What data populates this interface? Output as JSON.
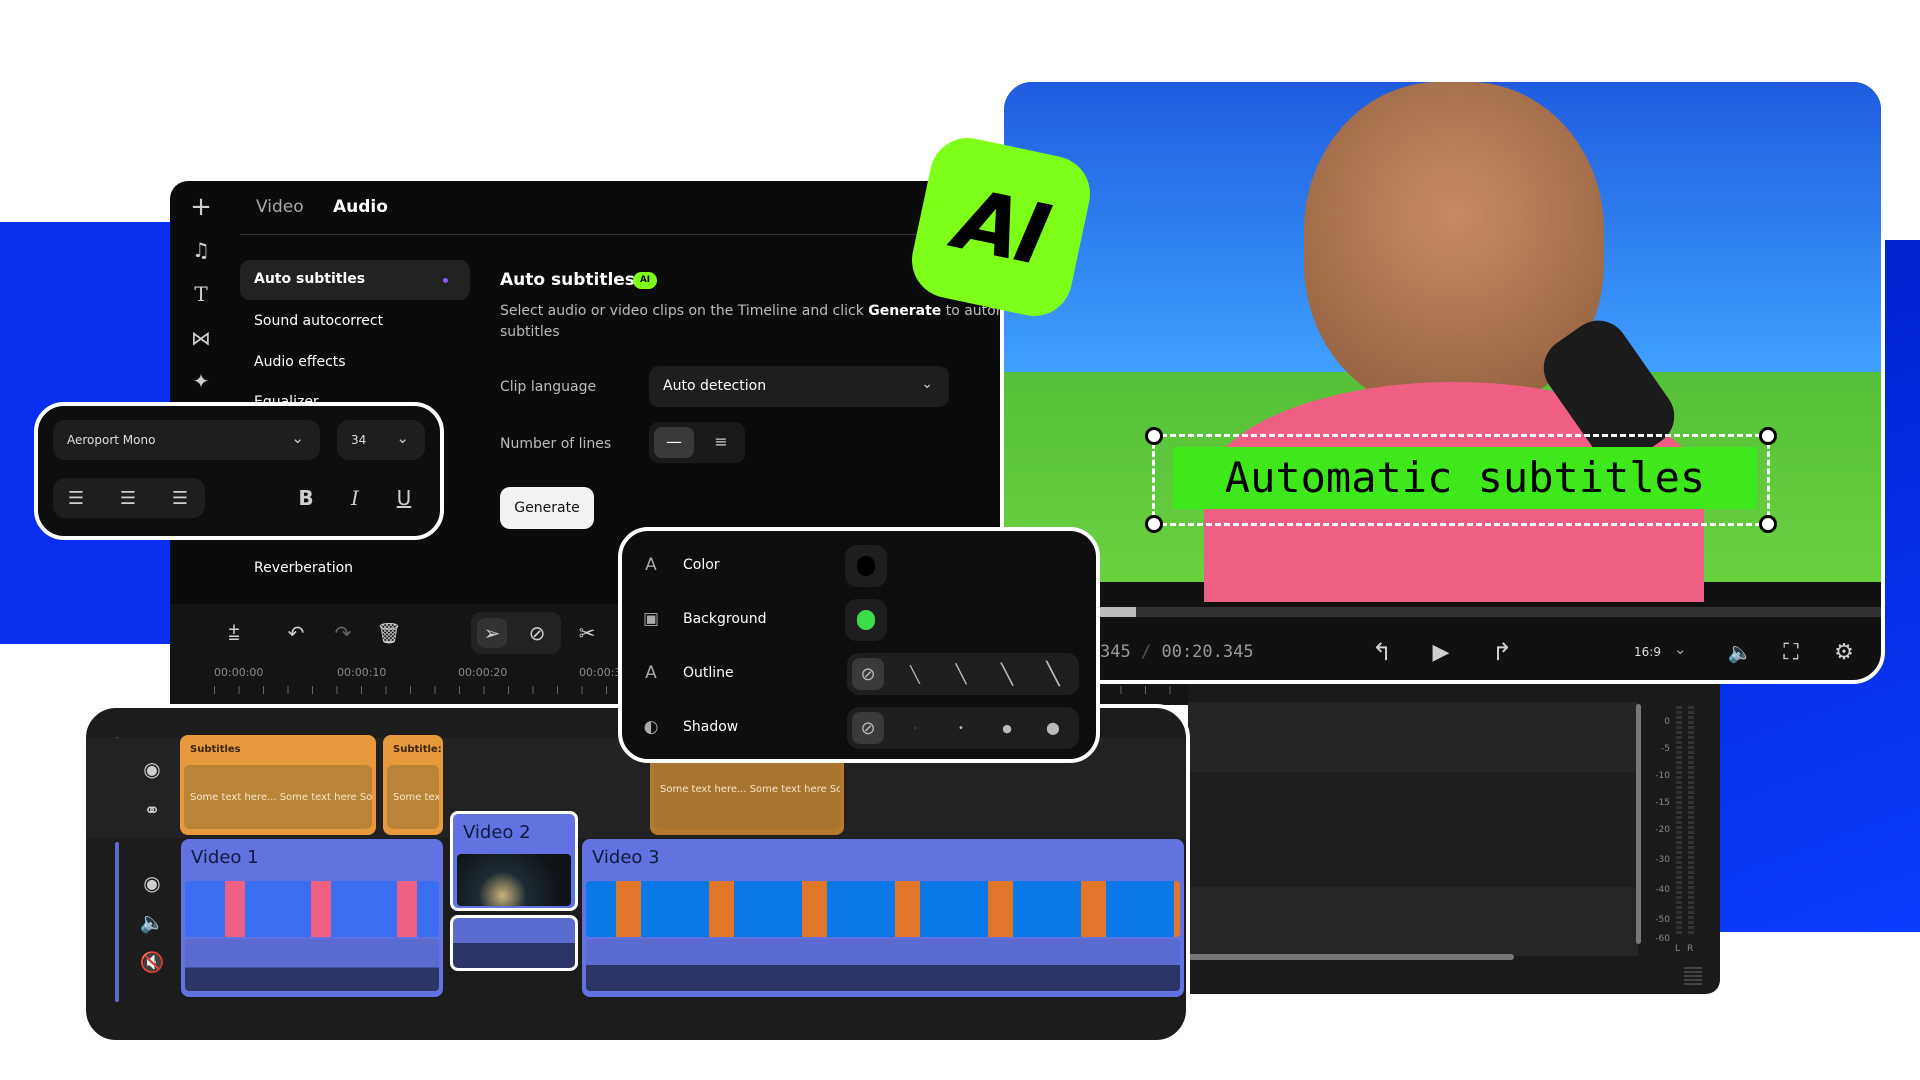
{
  "editor": {
    "tabs": [
      {
        "label": "Video",
        "active": false
      },
      {
        "label": "Audio",
        "active": true
      }
    ],
    "rail_icons": [
      "plus-icon",
      "music-icon",
      "text-icon",
      "transition-icon",
      "sparkle-icon"
    ],
    "menu": [
      {
        "label": "Auto subtitles",
        "active": true
      },
      {
        "label": "Sound autocorrect"
      },
      {
        "label": "Audio effects"
      },
      {
        "label": "Equalizer"
      },
      {
        "label": "Reverberation"
      }
    ],
    "content": {
      "title": "Auto subtitles",
      "badge": "AI",
      "desc_pre": "Select audio or video clips on the Timeline and click ",
      "desc_bold": "Generate",
      "desc_post": " to automa",
      "desc_line2": "subtitles",
      "clip_language_label": "Clip language",
      "clip_language_value": "Auto detection",
      "lines_label": "Number of lines",
      "generate_label": "Generate"
    },
    "toolbar_times": [
      "00:00:00",
      "00:00:10",
      "00:00:20",
      "00:00:3"
    ]
  },
  "ai_badge": "AI",
  "font_panel": {
    "font": "Aeroport Mono",
    "size": "34",
    "style_buttons": [
      "B",
      "I",
      "U"
    ]
  },
  "style_panel": {
    "rows": [
      {
        "label": "Color",
        "swatch": "#000000"
      },
      {
        "label": "Background",
        "swatch": "#3ddc4a"
      },
      {
        "label": "Outline"
      },
      {
        "label": "Shadow"
      }
    ]
  },
  "preview": {
    "subtitle": "Automatic subtitles",
    "subtitle_bg": "#3ee81a",
    "progress": 0.15,
    "time_current": "345",
    "time_sep": "/",
    "time_total": "00:20.345",
    "aspect": "16:9"
  },
  "timeline": {
    "subtitle_clips": [
      {
        "title": "Subtitles",
        "text": "Some text here... Some text here Son"
      },
      {
        "title": "Subtitle:",
        "text": "Some text"
      },
      {
        "title": "",
        "text": "Some text here... Some text here So"
      }
    ],
    "video_clips": [
      {
        "title": "Video 1"
      },
      {
        "title": "Video 2"
      },
      {
        "title": "Video 3"
      }
    ]
  },
  "mixer": {
    "scale": [
      "0",
      "-5",
      "-10",
      "-15",
      "-20",
      "-30",
      "-40",
      "-50",
      "-60"
    ],
    "channels": [
      "L",
      "R"
    ]
  },
  "colors": {
    "accent_green": "#7dff1a",
    "brand_blue": "#0a2ff0",
    "subtitle_clip": "#e69a3c",
    "video_clip": "#6272e0"
  }
}
